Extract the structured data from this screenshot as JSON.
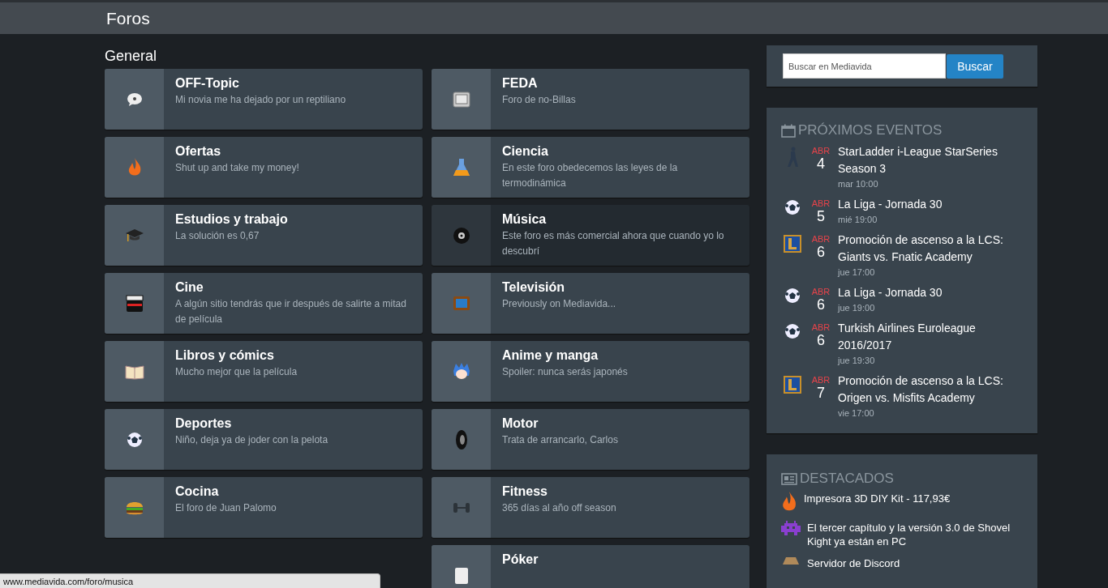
{
  "header": {
    "title": "Foros"
  },
  "section": {
    "title": "General"
  },
  "forums": [
    {
      "name": "OFF-Topic",
      "description": "Mi novia me ha dejado por un reptiliano",
      "hovered": false
    },
    {
      "name": "FEDA",
      "description": "Foro de no-Billas",
      "hovered": false
    },
    {
      "name": "Ofertas",
      "description": "Shut up and take my money!",
      "hovered": false
    },
    {
      "name": "Ciencia",
      "description": "En este foro obedecemos las leyes de la termodinámica",
      "hovered": false
    },
    {
      "name": "Estudios y trabajo",
      "description": "La solución es 0,67",
      "hovered": false
    },
    {
      "name": "Música",
      "description": "Este foro es más comercial ahora que cuando yo lo descubrí",
      "hovered": true
    },
    {
      "name": "Cine",
      "description": "A algún sitio tendrás que ir después de salirte a mitad de película",
      "hovered": false
    },
    {
      "name": "Televisión",
      "description": "Previously on Mediavida...",
      "hovered": false
    },
    {
      "name": "Libros y cómics",
      "description": "Mucho mejor que la película",
      "hovered": false
    },
    {
      "name": "Anime y manga",
      "description": "Spoiler: nunca serás japonés",
      "hovered": false
    },
    {
      "name": "Deportes",
      "description": "Niño, deja ya de joder con la pelota",
      "hovered": false
    },
    {
      "name": "Motor",
      "description": "Trata de arrancarlo, Carlos",
      "hovered": false
    },
    {
      "name": "Cocina",
      "description": "El foro de Juan Palomo",
      "hovered": false
    },
    {
      "name": "Fitness",
      "description": "365 días al año off season",
      "hovered": false
    },
    {
      "name": "Póker",
      "hovered": false
    }
  ],
  "search": {
    "placeholder": "Buscar en Mediavida",
    "button": "Buscar"
  },
  "events": {
    "title": "PRÓXIMOS EVENTOS",
    "items": [
      {
        "month": "ABR",
        "day": "4",
        "name": "StarLadder i-League StarSeries Season 3",
        "time": "mar 10:00"
      },
      {
        "month": "ABR",
        "day": "5",
        "name": "La Liga - Jornada 30",
        "time": "mié 19:00"
      },
      {
        "month": "ABR",
        "day": "6",
        "name": "Promoción de ascenso a la LCS: Giants vs. Fnatic Academy",
        "time": "jue 17:00"
      },
      {
        "month": "ABR",
        "day": "6",
        "name": "La Liga - Jornada 30",
        "time": "jue 19:00"
      },
      {
        "month": "ABR",
        "day": "6",
        "name": "Turkish Airlines Euroleague 2016/2017",
        "time": "jue 19:30"
      },
      {
        "month": "ABR",
        "day": "7",
        "name": "Promoción de ascenso a la LCS: Origen vs. Misfits Academy",
        "time": "vie 17:00"
      }
    ]
  },
  "featured": {
    "title": "DESTACADOS",
    "items": [
      {
        "text": "Impresora 3D DIY Kit - 117,93€"
      },
      {
        "text": "El tercer capítulo y la versión 3.0 de Shovel Kight ya están en PC"
      },
      {
        "text": "Servidor de Discord"
      }
    ]
  },
  "status_bar": {
    "url": "www.mediavida.com/foro/musica"
  }
}
